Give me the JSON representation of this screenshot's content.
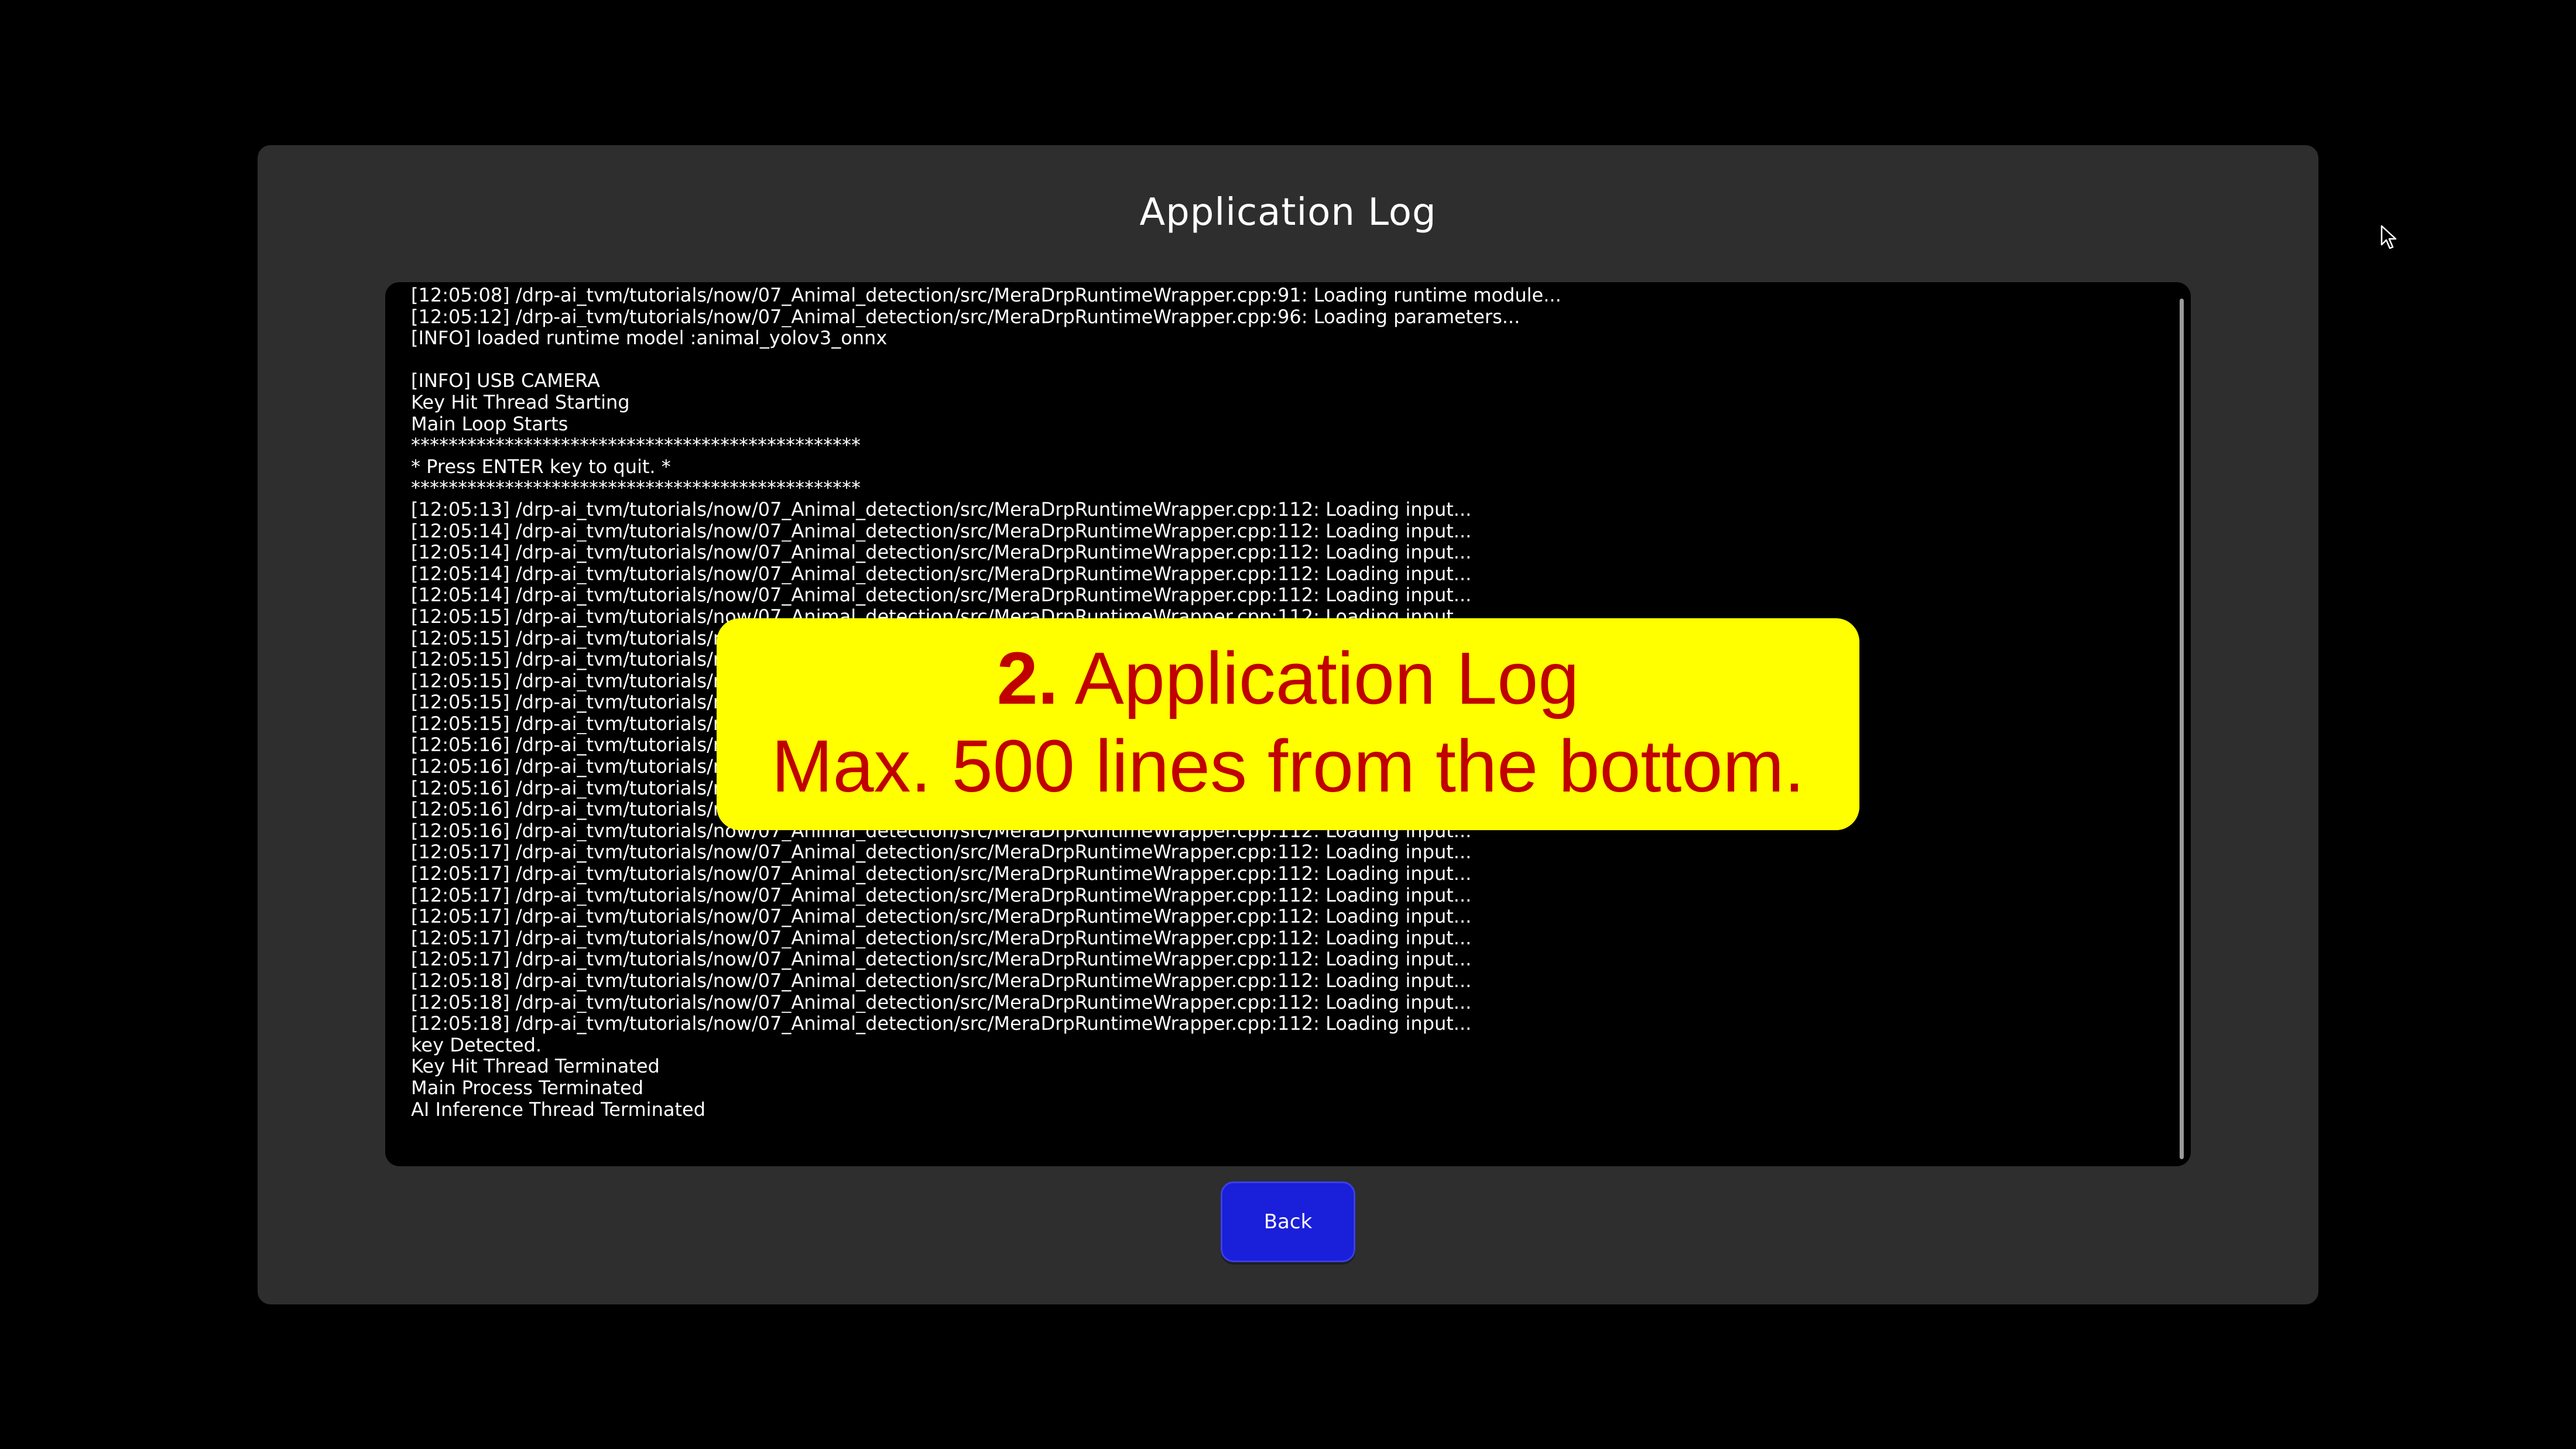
{
  "window": {
    "title": "Application Log"
  },
  "log": {
    "lines": [
      "[12:05:08] /drp-ai_tvm/tutorials/now/07_Animal_detection/src/MeraDrpRuntimeWrapper.cpp:91: Loading runtime module...",
      "[12:05:12] /drp-ai_tvm/tutorials/now/07_Animal_detection/src/MeraDrpRuntimeWrapper.cpp:96: Loading parameters...",
      "[INFO] loaded runtime model :animal_yolov3_onnx",
      "",
      "[INFO] USB CAMERA",
      "Key Hit Thread Starting",
      "Main Loop Starts",
      "************************************************",
      "* Press ENTER key to quit. *",
      "************************************************",
      "[12:05:13] /drp-ai_tvm/tutorials/now/07_Animal_detection/src/MeraDrpRuntimeWrapper.cpp:112: Loading input...",
      "[12:05:14] /drp-ai_tvm/tutorials/now/07_Animal_detection/src/MeraDrpRuntimeWrapper.cpp:112: Loading input...",
      "[12:05:14] /drp-ai_tvm/tutorials/now/07_Animal_detection/src/MeraDrpRuntimeWrapper.cpp:112: Loading input...",
      "[12:05:14] /drp-ai_tvm/tutorials/now/07_Animal_detection/src/MeraDrpRuntimeWrapper.cpp:112: Loading input...",
      "[12:05:14] /drp-ai_tvm/tutorials/now/07_Animal_detection/src/MeraDrpRuntimeWrapper.cpp:112: Loading input...",
      "[12:05:15] /drp-ai_tvm/tutorials/now/07_Animal_detection/src/MeraDrpRuntimeWrapper.cpp:112: Loading input...",
      "[12:05:15] /drp-ai_tvm/tutorials/now/07_Animal_detection/src/MeraDrpRuntimeWrapper.cpp:112: Loading input...",
      "[12:05:15] /drp-ai_tvm/tutorials/now/07_Animal_detection/src/MeraDrpRuntimeWrapper.cpp:112: Loading input...",
      "[12:05:15] /drp-ai_tvm/tutorials/now/07_Animal_detection/src/MeraDrpRuntimeWrapper.cpp:112: Loading input...",
      "[12:05:15] /drp-ai_tvm/tutorials/now/07_Animal_detection/src/MeraDrpRuntimeWrapper.cpp:112: Loading input...",
      "[12:05:15] /drp-ai_tvm/tutorials/now/07_Animal_detection/src/MeraDrpRuntimeWrapper.cpp:112: Loading input...",
      "[12:05:16] /drp-ai_tvm/tutorials/now/07_Animal_detection/src/MeraDrpRuntimeWrapper.cpp:112: Loading input...",
      "[12:05:16] /drp-ai_tvm/tutorials/now/07_Animal_detection/src/MeraDrpRuntimeWrapper.cpp:112: Loading input...",
      "[12:05:16] /drp-ai_tvm/tutorials/now/07_Animal_detection/src/MeraDrpRuntimeWrapper.cpp:112: Loading input...",
      "[12:05:16] /drp-ai_tvm/tutorials/now/07_Animal_detection/src/MeraDrpRuntimeWrapper.cpp:112: Loading input...",
      "[12:05:16] /drp-ai_tvm/tutorials/now/07_Animal_detection/src/MeraDrpRuntimeWrapper.cpp:112: Loading input...",
      "[12:05:17] /drp-ai_tvm/tutorials/now/07_Animal_detection/src/MeraDrpRuntimeWrapper.cpp:112: Loading input...",
      "[12:05:17] /drp-ai_tvm/tutorials/now/07_Animal_detection/src/MeraDrpRuntimeWrapper.cpp:112: Loading input...",
      "[12:05:17] /drp-ai_tvm/tutorials/now/07_Animal_detection/src/MeraDrpRuntimeWrapper.cpp:112: Loading input...",
      "[12:05:17] /drp-ai_tvm/tutorials/now/07_Animal_detection/src/MeraDrpRuntimeWrapper.cpp:112: Loading input...",
      "[12:05:17] /drp-ai_tvm/tutorials/now/07_Animal_detection/src/MeraDrpRuntimeWrapper.cpp:112: Loading input...",
      "[12:05:17] /drp-ai_tvm/tutorials/now/07_Animal_detection/src/MeraDrpRuntimeWrapper.cpp:112: Loading input...",
      "[12:05:18] /drp-ai_tvm/tutorials/now/07_Animal_detection/src/MeraDrpRuntimeWrapper.cpp:112: Loading input...",
      "[12:05:18] /drp-ai_tvm/tutorials/now/07_Animal_detection/src/MeraDrpRuntimeWrapper.cpp:112: Loading input...",
      "[12:05:18] /drp-ai_tvm/tutorials/now/07_Animal_detection/src/MeraDrpRuntimeWrapper.cpp:112: Loading input...",
      "key Detected.",
      "Key Hit Thread Terminated",
      "Main Process Terminated",
      "AI Inference Thread Terminated"
    ]
  },
  "footer": {
    "back_label": "Back"
  },
  "callout": {
    "number": "2.",
    "title": " Application Log",
    "subtitle": "Max. 500 lines from the bottom."
  },
  "colors": {
    "background": "#000000",
    "panel": "#2e2e2e",
    "log_background": "#000000",
    "back_button": "#1a1fd9",
    "callout_background": "#ffff00",
    "callout_text": "#c00000"
  },
  "icons": {
    "cursor": "mouse-pointer-icon"
  }
}
